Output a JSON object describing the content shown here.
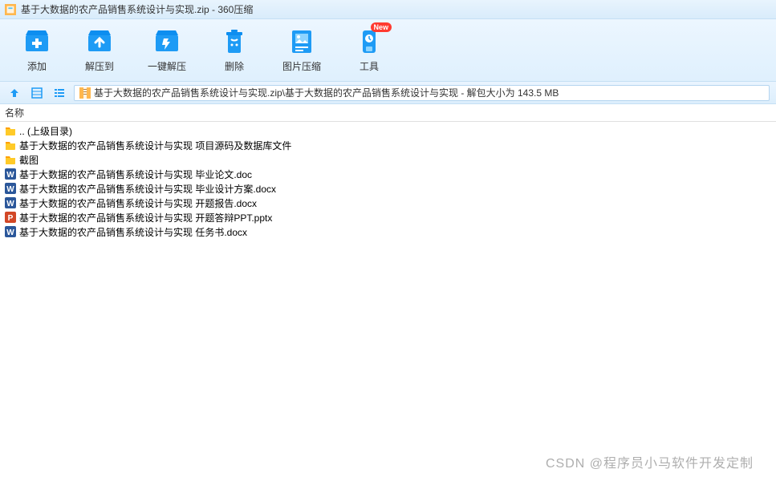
{
  "window": {
    "title": "基于大数据的农产品销售系统设计与实现.zip - 360压缩"
  },
  "toolbar": {
    "add": "添加",
    "extract_to": "解压到",
    "one_click_extract": "一键解压",
    "delete": "删除",
    "image_compress": "图片压缩",
    "tools": "工具",
    "new_badge": "New"
  },
  "addressbar": {
    "path": "基于大数据的农产品销售系统设计与实现.zip\\基于大数据的农产品销售系统设计与实现 - 解包大小为 143.5 MB"
  },
  "columns": {
    "name": "名称"
  },
  "files": [
    {
      "icon": "folder",
      "name": ".. (上级目录)"
    },
    {
      "icon": "folder",
      "name": "基于大数据的农产品销售系统设计与实现 项目源码及数据库文件"
    },
    {
      "icon": "folder",
      "name": "截图"
    },
    {
      "icon": "word",
      "name": "基于大数据的农产品销售系统设计与实现 毕业论文.doc"
    },
    {
      "icon": "word",
      "name": "基于大数据的农产品销售系统设计与实现 毕业设计方案.docx"
    },
    {
      "icon": "word",
      "name": "基于大数据的农产品销售系统设计与实现 开题报告.docx"
    },
    {
      "icon": "ppt",
      "name": "基于大数据的农产品销售系统设计与实现 开题答辩PPT.pptx"
    },
    {
      "icon": "word",
      "name": "基于大数据的农产品销售系统设计与实现 任务书.docx"
    }
  ],
  "watermark": "CSDN @程序员小马软件开发定制"
}
